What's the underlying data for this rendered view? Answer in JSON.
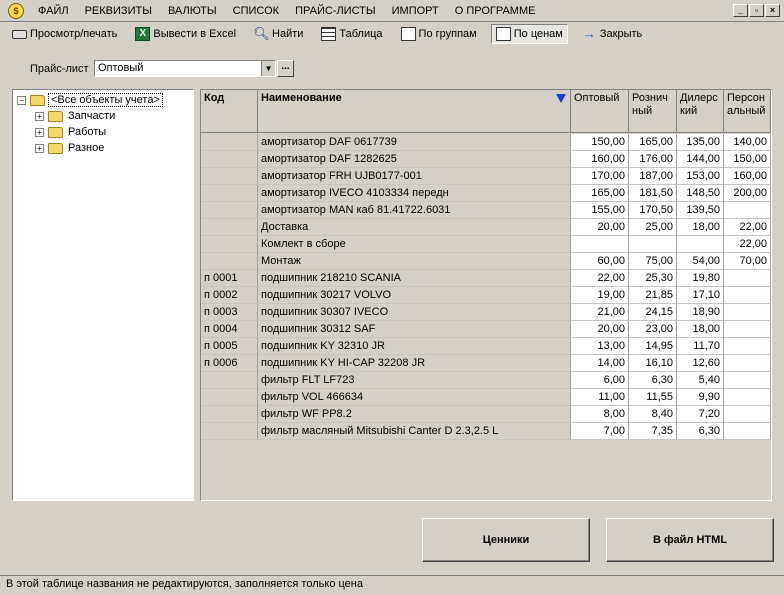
{
  "menu": [
    "ФАЙЛ",
    "РЕКВИЗИТЫ",
    "ВАЛЮТЫ",
    "СПИСОК",
    "ПРАЙС-ЛИСТЫ",
    "ИМПОРТ",
    "О ПРОГРАММЕ"
  ],
  "window_buttons": {
    "minimize": "_",
    "restore": "▫",
    "close": "×"
  },
  "toolbar": {
    "preview": "Просмотр/печать",
    "excel": "Вывести в Excel",
    "find": "Найти",
    "table": "Таблица",
    "by_groups": "По группам",
    "by_prices": "По ценам",
    "close": "Закрыть"
  },
  "pricelist": {
    "label": "Прайс-лист",
    "value": "Оптовый",
    "dots": "..."
  },
  "tree": {
    "root": "<Все объекты учета>",
    "children": [
      "Запчасти",
      "Работы",
      "Разное"
    ]
  },
  "grid": {
    "headers": {
      "code": "Код",
      "name": "Наименование",
      "opt": "Оптовый",
      "ret": "Розничный",
      "dil": "Дилерский",
      "per": "Персональный"
    },
    "header_lines": {
      "ret": [
        "Рознич",
        "ный"
      ],
      "dil": [
        "Дилерс",
        "кий"
      ],
      "per": [
        "Персон",
        "альный"
      ]
    },
    "rows": [
      {
        "code": "",
        "name": "амортизатор DAF 0617739",
        "opt": "150,00",
        "ret": "165,00",
        "dil": "135,00",
        "per": "140,00"
      },
      {
        "code": "",
        "name": "амортизатор DAF 1282625",
        "opt": "160,00",
        "ret": "176,00",
        "dil": "144,00",
        "per": "150,00"
      },
      {
        "code": "",
        "name": "амортизатор FRH UJB0177-001",
        "opt": "170,00",
        "ret": "187,00",
        "dil": "153,00",
        "per": "160,00"
      },
      {
        "code": "",
        "name": "амортизатор IVECO 4103334 передн",
        "opt": "165,00",
        "ret": "181,50",
        "dil": "148,50",
        "per": "200,00"
      },
      {
        "code": "",
        "name": "амортизатор MAN каб 81.41722.6031",
        "opt": "155,00",
        "ret": "170,50",
        "dil": "139,50",
        "per": ""
      },
      {
        "code": "",
        "name": "Доставка",
        "opt": "20,00",
        "ret": "25,00",
        "dil": "18,00",
        "per": "22,00"
      },
      {
        "code": "",
        "name": "Комлект в сборе",
        "opt": "",
        "ret": "",
        "dil": "",
        "per": "22,00"
      },
      {
        "code": "",
        "name": "Монтаж",
        "opt": "60,00",
        "ret": "75,00",
        "dil": "54,00",
        "per": "70,00"
      },
      {
        "code": "п 0001",
        "name": "подшипник 218210 SCANIA",
        "opt": "22,00",
        "ret": "25,30",
        "dil": "19,80",
        "per": ""
      },
      {
        "code": "п 0002",
        "name": "подшипник 30217 VOLVO",
        "opt": "19,00",
        "ret": "21,85",
        "dil": "17,10",
        "per": ""
      },
      {
        "code": "п 0003",
        "name": "подшипник 30307 IVECO",
        "opt": "21,00",
        "ret": "24,15",
        "dil": "18,90",
        "per": ""
      },
      {
        "code": "п 0004",
        "name": "подшипник 30312 SAF",
        "opt": "20,00",
        "ret": "23,00",
        "dil": "18,00",
        "per": ""
      },
      {
        "code": "п 0005",
        "name": "подшипник KY 32310 JR",
        "opt": "13,00",
        "ret": "14,95",
        "dil": "11,70",
        "per": ""
      },
      {
        "code": "п 0006",
        "name": "подшипник KY HI-CAP 32208 JR",
        "opt": "14,00",
        "ret": "16,10",
        "dil": "12,60",
        "per": ""
      },
      {
        "code": "",
        "name": "фильтр FLT LF723",
        "opt": "6,00",
        "ret": "6,30",
        "dil": "5,40",
        "per": ""
      },
      {
        "code": "",
        "name": "фильтр VOL 466634",
        "opt": "11,00",
        "ret": "11,55",
        "dil": "9,90",
        "per": ""
      },
      {
        "code": "",
        "name": "фильтр WF PP8.2",
        "opt": "8,00",
        "ret": "8,40",
        "dil": "7,20",
        "per": ""
      },
      {
        "code": "",
        "name": "фильтр масляный Mitsubishi Canter D 2.3,2.5 L",
        "opt": "7,00",
        "ret": "7,35",
        "dil": "6,30",
        "per": ""
      }
    ]
  },
  "buttons": {
    "price_tags": "Ценники",
    "to_html": "В файл HTML"
  },
  "status": "В этой таблице названия не редактируются, заполняется только цена"
}
